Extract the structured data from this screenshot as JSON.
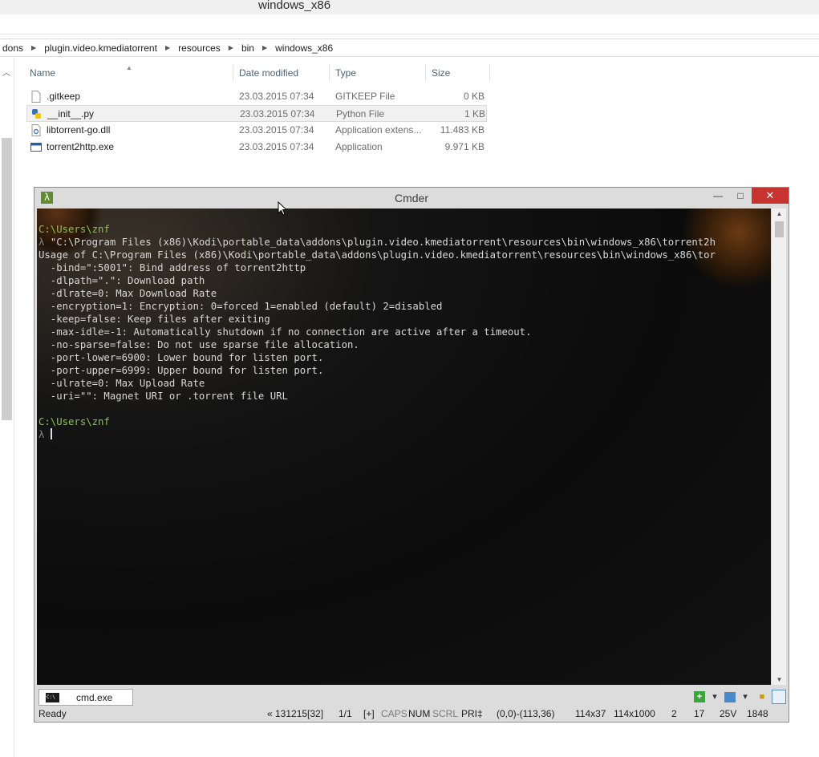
{
  "explorer": {
    "window_title": "windows_x86",
    "breadcrumbs": [
      "dons",
      "plugin.video.kmediatorrent",
      "resources",
      "bin",
      "windows_x86"
    ],
    "columns": {
      "name": "Name",
      "date": "Date modified",
      "type": "Type",
      "size": "Size"
    },
    "files": [
      {
        "name": ".gitkeep",
        "date": "23.03.2015 07:34",
        "type": "GITKEEP File",
        "size": "0 KB",
        "icon": "blank-file-icon"
      },
      {
        "name": "__init__.py",
        "date": "23.03.2015 07:34",
        "type": "Python File",
        "size": "1 KB",
        "icon": "python-file-icon"
      },
      {
        "name": "libtorrent-go.dll",
        "date": "23.03.2015 07:34",
        "type": "Application extens...",
        "size": "11.483 KB",
        "icon": "dll-file-icon"
      },
      {
        "name": "torrent2http.exe",
        "date": "23.03.2015 07:34",
        "type": "Application",
        "size": "9.971 KB",
        "icon": "exe-file-icon"
      }
    ]
  },
  "cmder": {
    "title": "Cmder",
    "lambda": "λ",
    "console": {
      "prompt_path": "C:\\Users\\znf",
      "prompt_symbol": "λ",
      "command": "\"C:\\Program Files (x86)\\Kodi\\portable_data\\addons\\plugin.video.kmediatorrent\\resources\\bin\\windows_x86\\torrent2h",
      "usage": "Usage of C:\\Program Files (x86)\\Kodi\\portable_data\\addons\\plugin.video.kmediatorrent\\resources\\bin\\windows_x86\\tor",
      "options": [
        "  -bind=\":5001\": Bind address of torrent2http",
        "  -dlpath=\".\": Download path",
        "  -dlrate=0: Max Download Rate",
        "  -encryption=1: Encryption: 0=forced 1=enabled (default) 2=disabled",
        "  -keep=false: Keep files after exiting",
        "  -max-idle=-1: Automatically shutdown if no connection are active after a timeout.",
        "  -no-sparse=false: Do not use sparse file allocation.",
        "  -port-lower=6900: Lower bound for listen port.",
        "  -port-upper=6999: Upper bound for listen port.",
        "  -ulrate=0: Max Upload Rate",
        "  -uri=\"\": Magnet URI or .torrent file URL"
      ]
    },
    "tab": {
      "label": "cmd.exe",
      "icon_text": "C:\\"
    },
    "status": {
      "ready": "Ready",
      "pos": "« 131215[32]",
      "page": "1/1",
      "plus": "[+]",
      "caps": "CAPS",
      "num": "NUM",
      "scrl": "SCRL",
      "pri": "PRI‡",
      "sel": "(0,0)-(113,36)",
      "size1": "114x37",
      "size2": "114x1000",
      "n1": "2",
      "n2": "17",
      "v": "25V",
      "n3": "1848"
    }
  },
  "colors": {
    "prompt_green": "#8bc34a",
    "close_red": "#c7332f",
    "lambda_green": "#5f8d2b"
  }
}
